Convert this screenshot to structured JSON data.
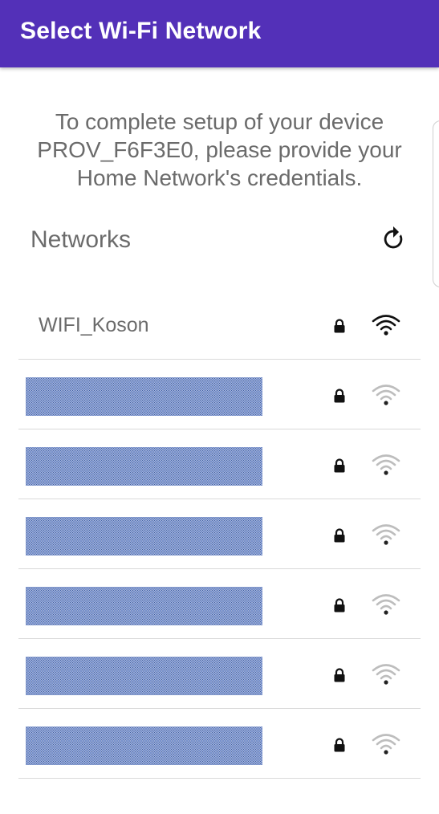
{
  "app_bar": {
    "title": "Select Wi-Fi Network",
    "background_color": "#5330b8"
  },
  "intro": {
    "text": "To complete setup of your device PROV_F6F3E0, please provide your Home Network's credentials."
  },
  "networks_section": {
    "header": "Networks",
    "refresh_icon": "refresh-icon"
  },
  "networks": [
    {
      "ssid": "WIFI_Koson",
      "redacted": false,
      "secured": true,
      "signal": "strong"
    },
    {
      "ssid": "",
      "redacted": true,
      "secured": true,
      "signal": "weak"
    },
    {
      "ssid": "",
      "redacted": true,
      "secured": true,
      "signal": "weak"
    },
    {
      "ssid": "",
      "redacted": true,
      "secured": true,
      "signal": "weak"
    },
    {
      "ssid": "",
      "redacted": true,
      "secured": true,
      "signal": "weak"
    },
    {
      "ssid": "",
      "redacted": true,
      "secured": true,
      "signal": "weak"
    },
    {
      "ssid": "",
      "redacted": true,
      "secured": true,
      "signal": "weak"
    }
  ],
  "colors": {
    "signal_strong": "#111111",
    "signal_weak": "#bdbdbd",
    "signal_weak_dot": "#222222",
    "text_secondary": "#6b6b6b"
  }
}
